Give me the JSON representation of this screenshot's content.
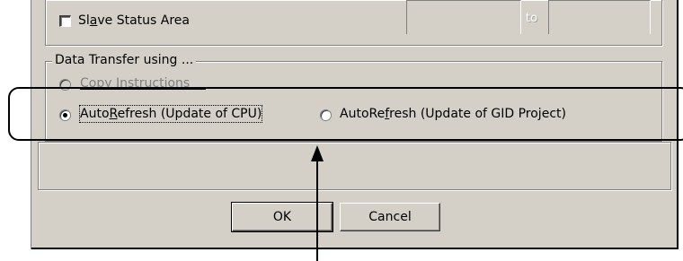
{
  "slave": {
    "label_pre": "Sl",
    "label_mnemonic": "a",
    "label_post": "ve Status Area",
    "checked": false,
    "to_label": "to"
  },
  "data_transfer": {
    "title": "Data Transfer using ...",
    "copy": {
      "pre": "",
      "mnemonic": "C",
      "post": "opy Instructions",
      "enabled": false
    },
    "cpu": {
      "pre": "Auto",
      "mnemonic": "R",
      "post": "efresh (Update of CPU)",
      "selected": true
    },
    "gid": {
      "pre": "AutoRe",
      "mnemonic": "f",
      "post": "resh (Update of GID Project)",
      "selected": false
    }
  },
  "buttons": {
    "ok": "OK",
    "cancel": "Cancel"
  }
}
